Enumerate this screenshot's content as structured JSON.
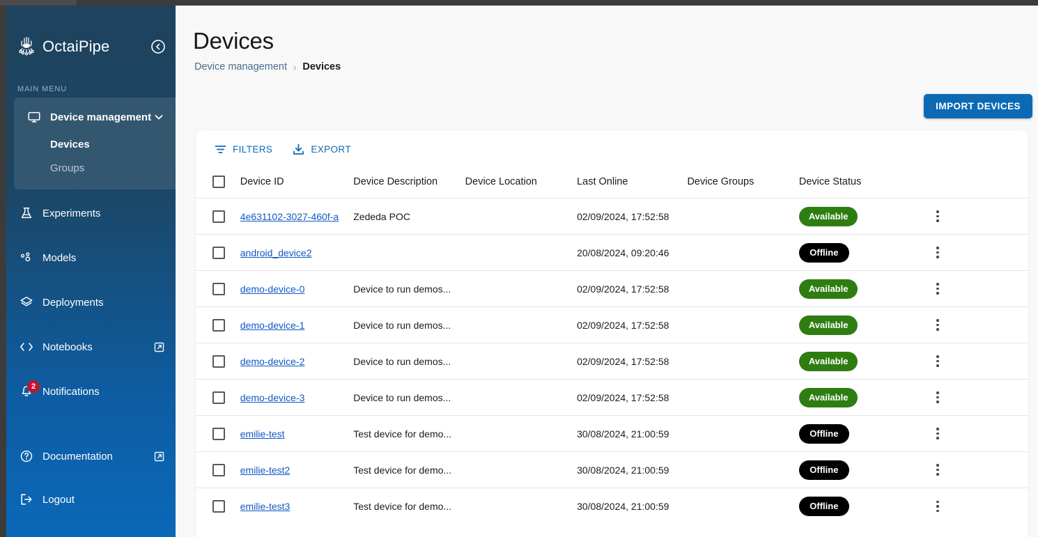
{
  "sidebar": {
    "brand": "OctaiPipe",
    "logo_icon": "octopus-logo-icon",
    "collapse_icon": "collapse-arrow-left-icon",
    "section_label": "MAIN MENU",
    "active_group": {
      "label": "Device management",
      "icon": "monitor-icon",
      "chevron": "chevron-down-icon",
      "sub_items": [
        {
          "label": "Devices",
          "active": true
        },
        {
          "label": "Groups",
          "active": false
        }
      ]
    },
    "items": [
      {
        "label": "Experiments",
        "icon": "flask-icon",
        "external": false
      },
      {
        "label": "Models",
        "icon": "model-nodes-icon",
        "external": false
      },
      {
        "label": "Deployments",
        "icon": "layers-icon",
        "external": false
      },
      {
        "label": "Notebooks",
        "icon": "code-brackets-icon",
        "external": true
      },
      {
        "label": "Notifications",
        "icon": "bell-icon",
        "external": false,
        "badge": "2"
      },
      {
        "label": "Documentation",
        "icon": "question-circle-icon",
        "external": true
      },
      {
        "label": "Logout",
        "icon": "logout-icon",
        "external": false
      }
    ]
  },
  "header": {
    "title": "Devices",
    "breadcrumb": {
      "parent": "Device management",
      "separator": "›",
      "current": "Devices"
    },
    "import_button": "IMPORT DEVICES"
  },
  "toolbar": {
    "filters_label": "FILTERS",
    "filters_icon": "filter-icon",
    "export_label": "EXPORT",
    "export_icon": "download-icon"
  },
  "table": {
    "select_all_checkbox": "unchecked",
    "columns": [
      "Device ID",
      "Device Description",
      "Device Location",
      "Last Online",
      "Device Groups",
      "Device Status"
    ],
    "row_menu_icon": "kebab-menu-icon",
    "rows": [
      {
        "checked": false,
        "device_id": "4e631102-3027-460f-a",
        "description": "Zededa POC",
        "location": "",
        "last_online": "02/09/2024, 17:52:58",
        "groups": "",
        "status": "Available"
      },
      {
        "checked": false,
        "device_id": "android_device2",
        "description": "",
        "location": "",
        "last_online": "20/08/2024, 09:20:46",
        "groups": "",
        "status": "Offline"
      },
      {
        "checked": false,
        "device_id": "demo-device-0",
        "description": "Device to run demos...",
        "location": "",
        "last_online": "02/09/2024, 17:52:58",
        "groups": "",
        "status": "Available"
      },
      {
        "checked": false,
        "device_id": "demo-device-1",
        "description": "Device to run demos...",
        "location": "",
        "last_online": "02/09/2024, 17:52:58",
        "groups": "",
        "status": "Available"
      },
      {
        "checked": false,
        "device_id": "demo-device-2",
        "description": "Device to run demos...",
        "location": "",
        "last_online": "02/09/2024, 17:52:58",
        "groups": "",
        "status": "Available"
      },
      {
        "checked": false,
        "device_id": "demo-device-3",
        "description": "Device to run demos...",
        "location": "",
        "last_online": "02/09/2024, 17:52:58",
        "groups": "",
        "status": "Available"
      },
      {
        "checked": false,
        "device_id": "emilie-test",
        "description": "Test device for demo...",
        "location": "",
        "last_online": "30/08/2024, 21:00:59",
        "groups": "",
        "status": "Offline"
      },
      {
        "checked": false,
        "device_id": "emilie-test2",
        "description": "Test device for demo...",
        "location": "",
        "last_online": "30/08/2024, 21:00:59",
        "groups": "",
        "status": "Offline"
      },
      {
        "checked": false,
        "device_id": "emilie-test3",
        "description": "Test device for demo...",
        "location": "",
        "last_online": "30/08/2024, 21:00:59",
        "groups": "",
        "status": "Offline"
      }
    ]
  },
  "colors": {
    "brand_blue": "#0c6ab5",
    "sidebar_top": "#1d435f",
    "sidebar_bottom": "#0a68b8",
    "link_blue": "#1059c4",
    "status_available": "#2e7d11",
    "status_offline": "#000000",
    "page_bg": "#f8f8f9"
  }
}
